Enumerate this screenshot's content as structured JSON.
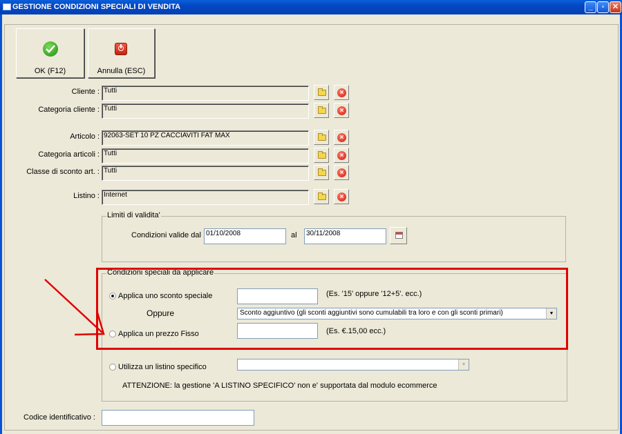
{
  "window": {
    "title": "GESTIONE CONDIZIONI SPECIALI DI VENDITA"
  },
  "toolbar": {
    "ok_label": "OK (F12)",
    "cancel_label": "Annulla (ESC)"
  },
  "fields": {
    "cliente": {
      "label": "Cliente :",
      "value": "Tutti"
    },
    "categoria_cliente": {
      "label": "Categoria cliente :",
      "value": "Tutti"
    },
    "articolo": {
      "label": "Articolo :",
      "value": "92063-SET 10 PZ CACCIAVITI FAT MAX"
    },
    "categoria_articoli": {
      "label": "Categoria articoli :",
      "value": "Tutti"
    },
    "classe_sconto": {
      "label": "Classe di sconto art. :",
      "value": "Tutti"
    },
    "listino": {
      "label": "Listino :",
      "value": "Internet"
    }
  },
  "validity": {
    "group_title": "Limiti di validita'",
    "from_label": "Condizioni valide dal",
    "from_value": "01/10/2008",
    "to_label": "al",
    "to_value": "30/11/2008"
  },
  "conditions": {
    "group_title": "Condizioni speciali da applicare",
    "discount_label": "Applica uno sconto speciale",
    "discount_value": "",
    "discount_hint": "(Es. '15' oppure '12+5'. ecc.)",
    "or_label": "Oppure",
    "discount_type": "Sconto aggiuntivo (gli sconti aggiuntivi sono cumulabili tra loro e con gli sconti primari)",
    "fixed_price_label": "Applica un prezzo Fisso",
    "fixed_price_value": "",
    "fixed_price_hint": "(Es. €.15,00 ecc.)",
    "selected": "discount"
  },
  "pricelist": {
    "label": "Utilizza un listino specifico",
    "value": "",
    "warning": "ATTENZIONE: la gestione 'A LISTINO SPECIFICO' non e' supportata dal modulo ecommerce"
  },
  "codice": {
    "label": "Codice identificativo :",
    "value": ""
  },
  "colors": {
    "title_bar": "#0447c2",
    "window_bg": "#ece9d8",
    "annotation": "#e00000"
  }
}
